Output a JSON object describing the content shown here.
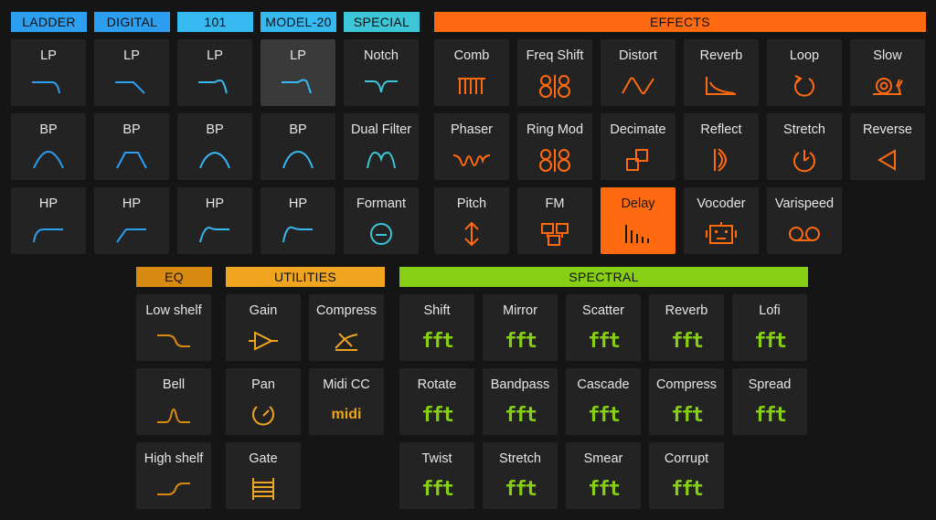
{
  "colors": {
    "filter": "#2d9ff0",
    "special": "#3cc6d8",
    "effects": "#ff6a10",
    "eq": "#d98a10",
    "utilities": "#f0a520",
    "spectral": "#86cf14"
  },
  "headers": {
    "ladder": "LADDER",
    "digital": "DIGITAL",
    "h101": "101",
    "model20": "MODEL-20",
    "special": "SPECIAL",
    "effects": "EFFECTS",
    "eq": "EQ",
    "utilities": "UTILITIES",
    "spectral": "SPECTRAL"
  },
  "filters": {
    "ladder": [
      "LP",
      "BP",
      "HP"
    ],
    "digital": [
      "LP",
      "BP",
      "HP"
    ],
    "h101": [
      "LP",
      "BP",
      "HP"
    ],
    "model20": [
      "LP",
      "BP",
      "HP"
    ],
    "special": [
      "Notch",
      "Dual Filter",
      "Formant"
    ]
  },
  "effects": {
    "row1": [
      "Comb",
      "Freq Shift",
      "Distort",
      "Reverb",
      "Loop",
      "Slow"
    ],
    "row2": [
      "Phaser",
      "Ring Mod",
      "Decimate",
      "Reflect",
      "Stretch",
      "Reverse"
    ],
    "row3": [
      "Pitch",
      "FM",
      "Delay",
      "Vocoder",
      "Varispeed"
    ]
  },
  "eq": [
    "Low shelf",
    "Bell",
    "High shelf"
  ],
  "utilities": {
    "col1": [
      "Gain",
      "Pan",
      "Gate"
    ],
    "col2": [
      "Compress",
      "Midi CC"
    ],
    "midi_icon": "midi"
  },
  "spectral": {
    "row1": [
      "Shift",
      "Mirror",
      "Scatter",
      "Reverb",
      "Lofi"
    ],
    "row2": [
      "Rotate",
      "Bandpass",
      "Cascade",
      "Compress",
      "Spread"
    ],
    "row3": [
      "Twist",
      "Stretch",
      "Smear",
      "Corrupt"
    ],
    "icon_text": "fft"
  }
}
